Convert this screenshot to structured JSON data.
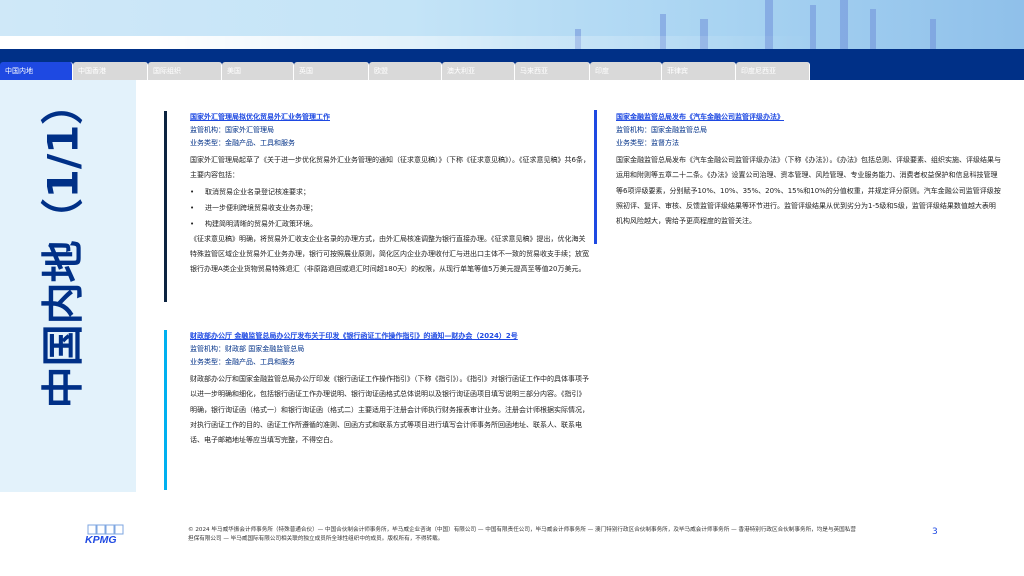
{
  "tabs": [
    "中国内地",
    "中国香港",
    "国际组织",
    "美国",
    "英国",
    "欧盟",
    "澳大利亚",
    "马来西亚",
    "印度",
    "菲律宾",
    "印度尼西亚"
  ],
  "page_title": "中国内地（1/1）",
  "articles": [
    {
      "title": "国家外汇管理局拟优化贸易外汇业务管理工作",
      "regulator": "监管机构：国家外汇管理局",
      "type": "业务类型：金融产品、工具和服务",
      "p1": "国家外汇管理局起草了《关于进一步优化贸易外汇业务管理的通知（征求意见稿）》（下称《征求意见稿》）。《征求意见稿》共6条，主要内容包括：",
      "bullets": [
        "取消贸易企业名录登记核准要求；",
        "进一步便利跨境贸易收支业务办理；",
        "构建简明清晰的贸易外汇政策环境。"
      ],
      "p2": "《征求意见稿》明确，将贸易外汇收支企业名录的办理方式，由外汇局核准调整为银行直接办理。《征求意见稿》提出，优化海关特殊监管区域企业贸易外汇业务办理，银行可按照展业原则，简化区内企业办理收付汇与进出口主体不一致的贸易收支手续；放宽银行办理A类企业货物贸易特殊退汇（非原路退回或退汇时间超180天）的权限，从现行单笔等值5万美元提高至等值20万美元。"
    },
    {
      "title": "财政部办公厅 金融监管总局办公厅发布关于印发《银行函证工作操作指引》的通知—财办会（2024）2号",
      "regulator": "监管机构：财政部 国家金融监管总局",
      "type": "业务类型：金融产品、工具和服务",
      "p1": "财政部办公厅和国家金融监管总局办公厅印发《银行函证工作操作指引》（下称《指引》）。《指引》对银行函证工作中的具体事项予以进一步明确和细化，包括银行函证工作办理说明、银行询证函格式总体说明以及银行询证函项目填写说明三部分内容。《指引》明确，银行询证函（格式一）和银行询证函（格式二）主要适用于注册会计师执行财务报表审计业务。注册会计师根据实际情况，对执行函证工作的目的、函证工作所遵循的准则、回函方式和联系方式等项目进行填写会计师事务所回函地址、联系人、联系电话、电子邮箱地址等应当填写完整，不得空白。"
    },
    {
      "title": "国家金融监管总局发布《汽车金融公司监管评级办法》",
      "regulator": "监管机构：国家金融监管总局",
      "type": "业务类型：监督方法",
      "p1": "国家金融监管总局发布《汽车金融公司监管评级办法》（下称《办法》）。《办法》包括总则、评级要素、组织实施、评级结果与运用和附则等五章二十二条。《办法》设置公司治理、资本管理、风险管理、专业服务能力、消费者权益保护和信息科技管理等6项评级要素，分别赋予10%、10%、35%、20%、15%和10%的分值权重，并规定评分原则。汽车金融公司监管评级按照初评、复评、审核、反馈监管评级结果等环节进行。监管评级结果从优到劣分为1-5级和S级，监管评级结果数值越大表明机构风险越大，需给予更高程度的监管关注。"
    }
  ],
  "footer": "© 2024 毕马威华振会计师事务所（特殊普通合伙）— 中国合伙制会计师事务所，毕马威企业咨询（中国）有限公司 — 中国有限责任公司，毕马威会计师事务所 — 澳门特别行政区合伙制事务所，及毕马威会计师事务所 — 香港特别行政区合伙制事务所，均是与英国私营担保有限公司 — 毕马威国际有限公司相关联的独立成员所全球性组织中的成员。版权所有，不得转载。",
  "page_number": "3",
  "logo": "KPMG"
}
